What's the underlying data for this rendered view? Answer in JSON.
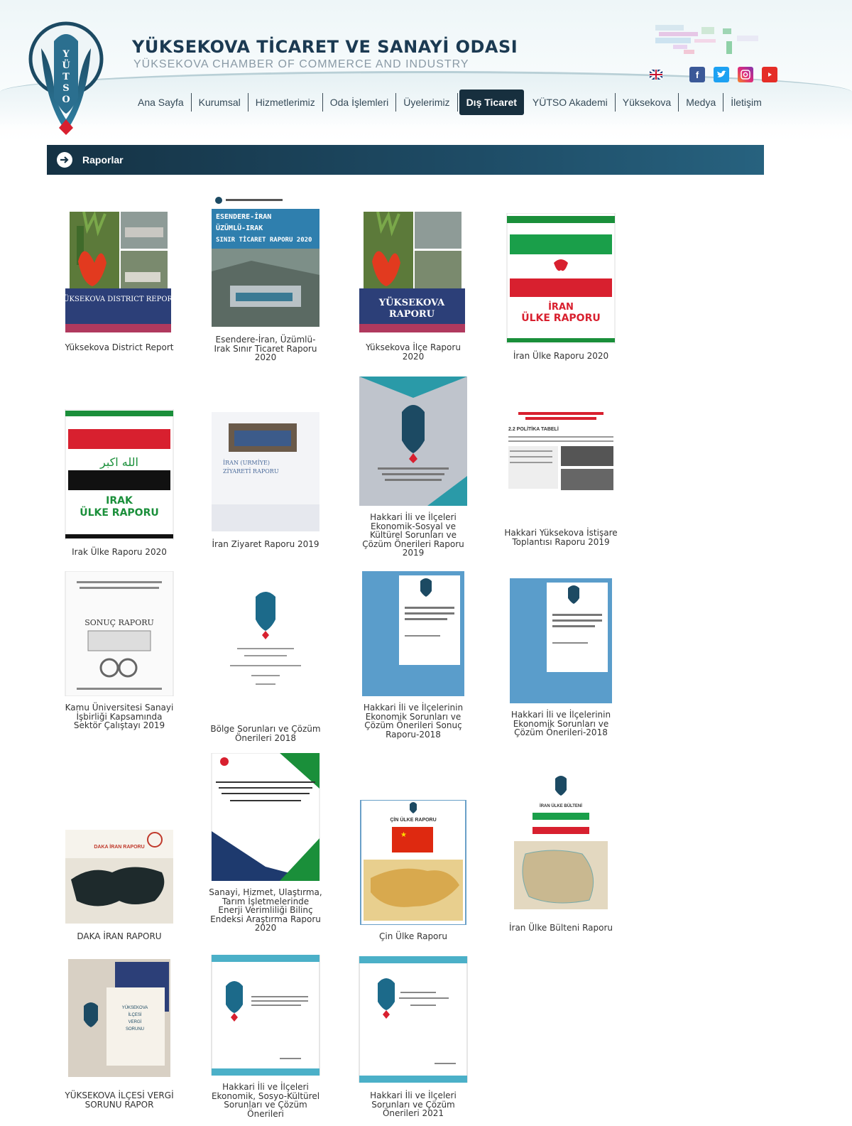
{
  "header": {
    "title": "YÜKSEKOVA TİCARET VE SANAYİ ODASI",
    "subtitle": "YÜKSEKOVA CHAMBER OF COMMERCE AND INDUSTRY",
    "logo_text": "YÜTSO"
  },
  "nav": [
    {
      "label": "Ana Sayfa",
      "active": false
    },
    {
      "label": "Kurumsal",
      "active": false
    },
    {
      "label": "Hizmetlerimiz",
      "active": false
    },
    {
      "label": "Oda İşlemleri",
      "active": false
    },
    {
      "label": "Üyelerimiz",
      "active": false
    },
    {
      "label": "Dış Ticaret",
      "active": true
    },
    {
      "label": "YÜTSO Akademi",
      "active": false
    },
    {
      "label": "Yüksekova",
      "active": false
    },
    {
      "label": "Medya",
      "active": false
    },
    {
      "label": "İletişim",
      "active": false
    }
  ],
  "social": [
    "language-icon",
    "facebook-icon",
    "twitter-icon",
    "instagram-icon",
    "youtube-icon"
  ],
  "panel": {
    "title": "Raporlar"
  },
  "reports": [
    {
      "caption": "Yüksekova District Report",
      "cover_text": "YÜKSEKOVA DISTRICT REPORT"
    },
    {
      "caption": "Esendere-İran, Üzümlü-Irak Sınır Ticaret Raporu 2020",
      "cover_text": "ESENDERE-İRAN ÜZÜMLÜ-IRAK SINIR TİCARET RAPORU 2020"
    },
    {
      "caption": "Yüksekova İlçe Raporu 2020",
      "cover_text": "YÜKSEKOVA RAPORU"
    },
    {
      "caption": "İran Ülke Raporu 2020",
      "cover_text": "İRAN ÜLKE RAPORU"
    },
    {
      "caption": "Irak Ülke Raporu 2020",
      "cover_text": "IRAK ÜLKE RAPORU"
    },
    {
      "caption": "İran Ziyaret Raporu 2019",
      "cover_text": "İRAN (URMİYE) ZİYARETİ RAPORU"
    },
    {
      "caption": "Hakkari İli ve İlçeleri Ekonomik-Sosyal ve Kültürel Sorunları ve Çözüm Önerileri Raporu 2019",
      "cover_text": ""
    },
    {
      "caption": "Hakkari Yüksekova İstişare Toplantısı Raporu 2019",
      "cover_text": "2.2 POLİTİKA TABELİ"
    },
    {
      "caption": "Kamu Üniversitesi Sanayi İşbirliği Kapsamında Sektör Çalıştayı 2019",
      "cover_text": "SONUÇ RAPORU"
    },
    {
      "caption": "Bölge Sorunları ve Çözüm Önerileri 2018",
      "cover_text": ""
    },
    {
      "caption": "Hakkari İli ve İlçelerinin Ekonomik Sorunları ve Çözüm Önerileri Sonuç Raporu-2018",
      "cover_text": ""
    },
    {
      "caption": "Hakkari İli ve İlçelerinin Ekonomik Sorunları ve Çözüm Önerileri-2018",
      "cover_text": ""
    },
    {
      "caption": "DAKA İRAN RAPORU",
      "cover_text": "DAKA İRAN RAPORU"
    },
    {
      "caption": "Sanayi, Hizmet, Ulaştırma, Tarım İşletmelerinde Enerji Verimliliği Bilinç Endeksi Araştırma Raporu 2020",
      "cover_text": "Sanayi, Hizmet, Ulaştırma, Tarım İşletmelerinde Enerji Verimliliği Bilinç Endeksi Araştırma Raporu 2020"
    },
    {
      "caption": "Çin Ülke Raporu",
      "cover_text": "ÇİN ÜLKE RAPORU"
    },
    {
      "caption": "İran Ülke Bülteni Raporu",
      "cover_text": "İRAN ÜLKE BÜLTENİ"
    },
    {
      "caption": "YÜKSEKOVA İLÇESİ VERGİ SORUNU RAPOR",
      "cover_text": "YÜKSEKOVA İLÇESİ VERGİ SORUNU"
    },
    {
      "caption": "Hakkari İli ve İlçeleri Ekonomik, Sosyo-Kültürel Sorunları ve Çözüm Önerileri",
      "cover_text": ""
    },
    {
      "caption": "Hakkari İli ve İlçeleri Sorunları ve Çözüm Önerileri 2021",
      "cover_text": ""
    }
  ],
  "colors": {
    "nav_active": "#172f3e",
    "panel_header": "#1e4c66",
    "text": "#333333"
  }
}
